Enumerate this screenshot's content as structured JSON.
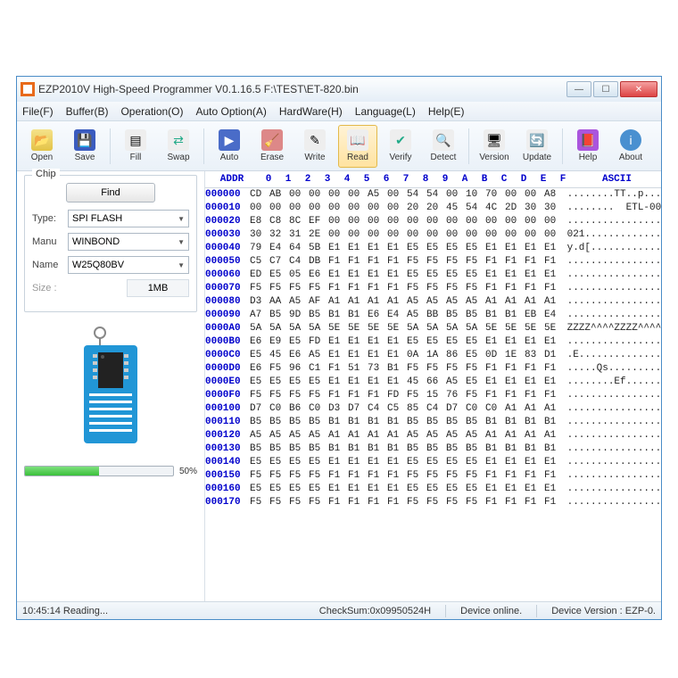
{
  "window": {
    "title": "EZP2010V High-Speed Programmer  V0.1.16.5    F:\\TEST\\ET-820.bin"
  },
  "menu": {
    "file": "File(F)",
    "buffer": "Buffer(B)",
    "operation": "Operation(O)",
    "autoOption": "Auto Option(A)",
    "hardware": "HardWare(H)",
    "language": "Language(L)",
    "help": "Help(E)"
  },
  "toolbar": {
    "open": "Open",
    "save": "Save",
    "fill": "Fill",
    "swap": "Swap",
    "auto": "Auto",
    "erase": "Erase",
    "write": "Write",
    "read": "Read",
    "verify": "Verify",
    "detect": "Detect",
    "version": "Version",
    "update": "Update",
    "help": "Help",
    "about": "About"
  },
  "chip": {
    "legend": "Chip",
    "find": "Find",
    "typeLabel": "Type:",
    "type": "SPI FLASH",
    "manuLabel": "Manu",
    "manu": "WINBOND",
    "nameLabel": "Name",
    "name": "W25Q80BV",
    "sizeLabel": "Size :",
    "size": "1MB"
  },
  "progress": {
    "percent": 50,
    "label": "50%"
  },
  "hex": {
    "addrHeader": "ADDR",
    "asciiHeader": "ASCII",
    "cols": [
      "0",
      "1",
      "2",
      "3",
      "4",
      "5",
      "6",
      "7",
      "8",
      "9",
      "A",
      "B",
      "C",
      "D",
      "E",
      "F"
    ],
    "rows": [
      {
        "addr": "000000",
        "b": [
          "CD",
          "AB",
          "00",
          "00",
          "00",
          "00",
          "A5",
          "00",
          "54",
          "54",
          "00",
          "10",
          "70",
          "00",
          "00",
          "A8"
        ],
        "a": "........TT..p..."
      },
      {
        "addr": "000010",
        "b": [
          "00",
          "00",
          "00",
          "00",
          "00",
          "00",
          "00",
          "00",
          "20",
          "20",
          "45",
          "54",
          "4C",
          "2D",
          "30",
          "30"
        ],
        "a": "........  ETL-00"
      },
      {
        "addr": "000020",
        "b": [
          "E8",
          "C8",
          "8C",
          "EF",
          "00",
          "00",
          "00",
          "00",
          "00",
          "00",
          "00",
          "00",
          "00",
          "00",
          "00",
          "00"
        ],
        "a": "................"
      },
      {
        "addr": "000030",
        "b": [
          "30",
          "32",
          "31",
          "2E",
          "00",
          "00",
          "00",
          "00",
          "00",
          "00",
          "00",
          "00",
          "00",
          "00",
          "00",
          "00"
        ],
        "a": "021............."
      },
      {
        "addr": "000040",
        "b": [
          "79",
          "E4",
          "64",
          "5B",
          "E1",
          "E1",
          "E1",
          "E1",
          "E5",
          "E5",
          "E5",
          "E5",
          "E1",
          "E1",
          "E1",
          "E1"
        ],
        "a": "y.d[............"
      },
      {
        "addr": "000050",
        "b": [
          "C5",
          "C7",
          "C4",
          "DB",
          "F1",
          "F1",
          "F1",
          "F1",
          "F5",
          "F5",
          "F5",
          "F5",
          "F1",
          "F1",
          "F1",
          "F1"
        ],
        "a": "................"
      },
      {
        "addr": "000060",
        "b": [
          "ED",
          "E5",
          "05",
          "E6",
          "E1",
          "E1",
          "E1",
          "E1",
          "E5",
          "E5",
          "E5",
          "E5",
          "E1",
          "E1",
          "E1",
          "E1"
        ],
        "a": "................"
      },
      {
        "addr": "000070",
        "b": [
          "F5",
          "F5",
          "F5",
          "F5",
          "F1",
          "F1",
          "F1",
          "F1",
          "F5",
          "F5",
          "F5",
          "F5",
          "F1",
          "F1",
          "F1",
          "F1"
        ],
        "a": "................"
      },
      {
        "addr": "000080",
        "b": [
          "D3",
          "AA",
          "A5",
          "AF",
          "A1",
          "A1",
          "A1",
          "A1",
          "A5",
          "A5",
          "A5",
          "A5",
          "A1",
          "A1",
          "A1",
          "A1"
        ],
        "a": "................"
      },
      {
        "addr": "000090",
        "b": [
          "A7",
          "B5",
          "9D",
          "B5",
          "B1",
          "B1",
          "E6",
          "E4",
          "A5",
          "BB",
          "B5",
          "B5",
          "B1",
          "B1",
          "EB",
          "E4"
        ],
        "a": "................"
      },
      {
        "addr": "0000A0",
        "b": [
          "5A",
          "5A",
          "5A",
          "5A",
          "5E",
          "5E",
          "5E",
          "5E",
          "5A",
          "5A",
          "5A",
          "5A",
          "5E",
          "5E",
          "5E",
          "5E"
        ],
        "a": "ZZZZ^^^^ZZZZ^^^^"
      },
      {
        "addr": "0000B0",
        "b": [
          "E6",
          "E9",
          "E5",
          "FD",
          "E1",
          "E1",
          "E1",
          "E1",
          "E5",
          "E5",
          "E5",
          "E5",
          "E1",
          "E1",
          "E1",
          "E1"
        ],
        "a": "................"
      },
      {
        "addr": "0000C0",
        "b": [
          "E5",
          "45",
          "E6",
          "A5",
          "E1",
          "E1",
          "E1",
          "E1",
          "0A",
          "1A",
          "86",
          "E5",
          "0D",
          "1E",
          "83",
          "D1"
        ],
        "a": ".E.............."
      },
      {
        "addr": "0000D0",
        "b": [
          "E6",
          "F5",
          "96",
          "C1",
          "F1",
          "51",
          "73",
          "B1",
          "F5",
          "F5",
          "F5",
          "F5",
          "F1",
          "F1",
          "F1",
          "F1"
        ],
        "a": ".....Qs........."
      },
      {
        "addr": "0000E0",
        "b": [
          "E5",
          "E5",
          "E5",
          "E5",
          "E1",
          "E1",
          "E1",
          "E1",
          "45",
          "66",
          "A5",
          "E5",
          "E1",
          "E1",
          "E1",
          "E1"
        ],
        "a": "........Ef......"
      },
      {
        "addr": "0000F0",
        "b": [
          "F5",
          "F5",
          "F5",
          "F5",
          "F1",
          "F1",
          "F1",
          "FD",
          "F5",
          "15",
          "76",
          "F5",
          "F1",
          "F1",
          "F1",
          "F1"
        ],
        "a": "................"
      },
      {
        "addr": "000100",
        "b": [
          "D7",
          "C0",
          "B6",
          "C0",
          "D3",
          "D7",
          "C4",
          "C5",
          "85",
          "C4",
          "D7",
          "C0",
          "C0",
          "A1",
          "A1",
          "A1"
        ],
        "a": "................"
      },
      {
        "addr": "000110",
        "b": [
          "B5",
          "B5",
          "B5",
          "B5",
          "B1",
          "B1",
          "B1",
          "B1",
          "B5",
          "B5",
          "B5",
          "B5",
          "B1",
          "B1",
          "B1",
          "B1"
        ],
        "a": "................"
      },
      {
        "addr": "000120",
        "b": [
          "A5",
          "A5",
          "A5",
          "A5",
          "A1",
          "A1",
          "A1",
          "A1",
          "A5",
          "A5",
          "A5",
          "A5",
          "A1",
          "A1",
          "A1",
          "A1"
        ],
        "a": "................"
      },
      {
        "addr": "000130",
        "b": [
          "B5",
          "B5",
          "B5",
          "B5",
          "B1",
          "B1",
          "B1",
          "B1",
          "B5",
          "B5",
          "B5",
          "B5",
          "B1",
          "B1",
          "B1",
          "B1"
        ],
        "a": "................"
      },
      {
        "addr": "000140",
        "b": [
          "E5",
          "E5",
          "E5",
          "E5",
          "E1",
          "E1",
          "E1",
          "E1",
          "E5",
          "E5",
          "E5",
          "E5",
          "E1",
          "E1",
          "E1",
          "E1"
        ],
        "a": "................"
      },
      {
        "addr": "000150",
        "b": [
          "F5",
          "F5",
          "F5",
          "F5",
          "F1",
          "F1",
          "F1",
          "F1",
          "F5",
          "F5",
          "F5",
          "F5",
          "F1",
          "F1",
          "F1",
          "F1"
        ],
        "a": "................"
      },
      {
        "addr": "000160",
        "b": [
          "E5",
          "E5",
          "E5",
          "E5",
          "E1",
          "E1",
          "E1",
          "E1",
          "E5",
          "E5",
          "E5",
          "E5",
          "E1",
          "E1",
          "E1",
          "E1"
        ],
        "a": "................"
      },
      {
        "addr": "000170",
        "b": [
          "F5",
          "F5",
          "F5",
          "F5",
          "F1",
          "F1",
          "F1",
          "F1",
          "F5",
          "F5",
          "F5",
          "F5",
          "F1",
          "F1",
          "F1",
          "F1"
        ],
        "a": "................"
      }
    ]
  },
  "status": {
    "time": "10:45:14 Reading...",
    "checksum": "CheckSum:0x09950524H",
    "device": "Device online.",
    "version": "Device Version : EZP-0."
  }
}
